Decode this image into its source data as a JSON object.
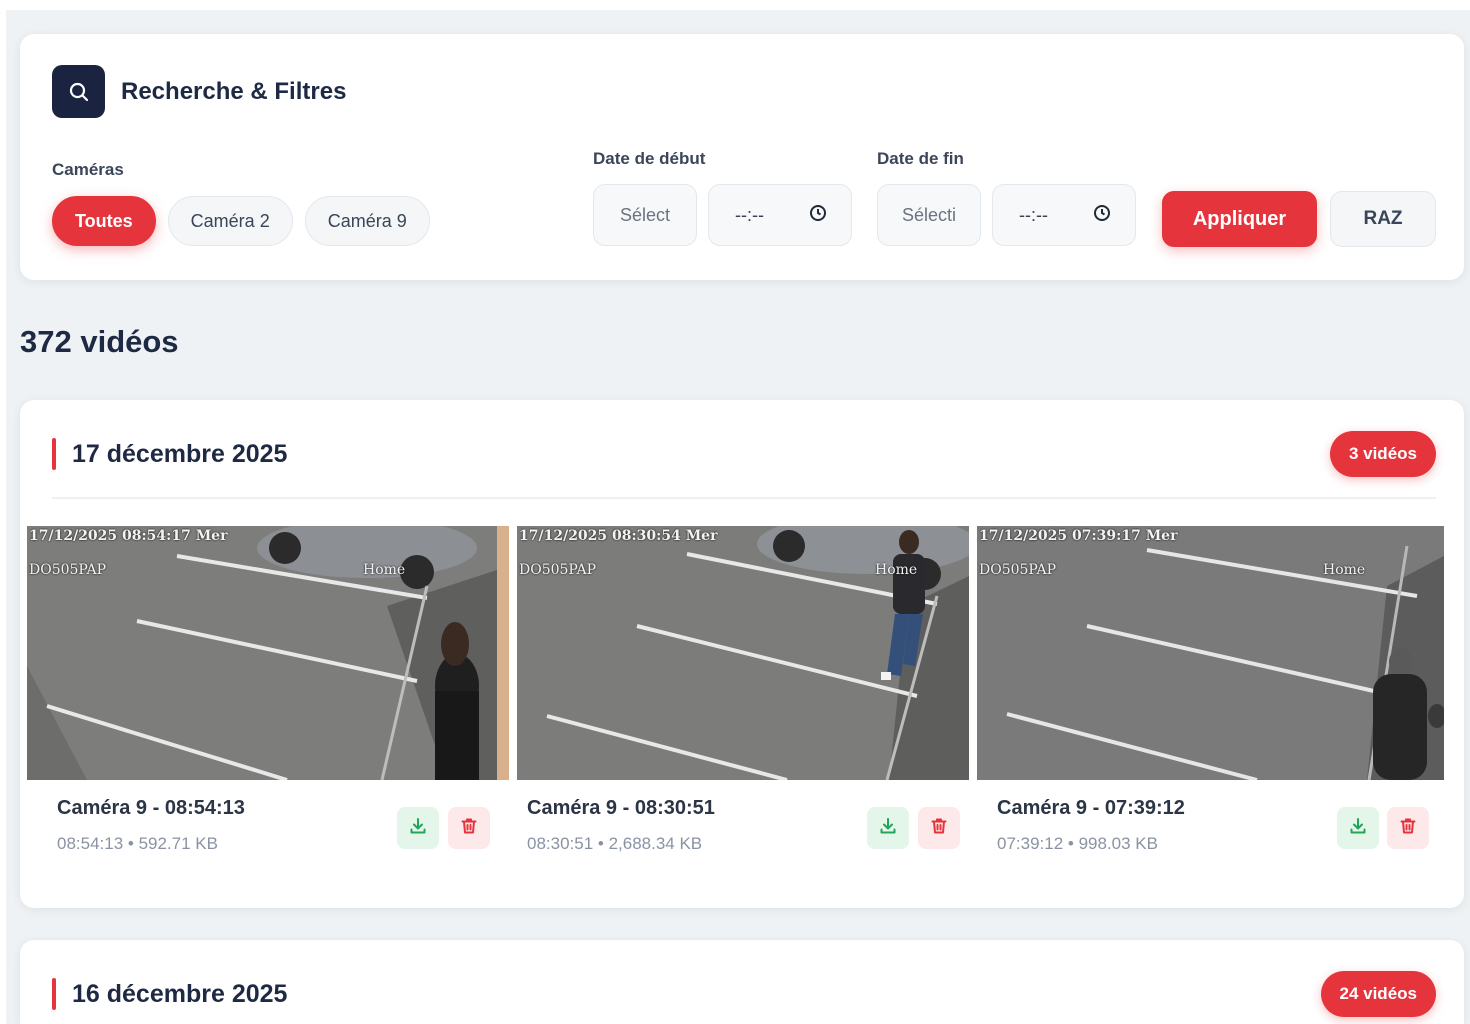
{
  "filters": {
    "title": "Recherche & Filtres",
    "cameras_label": "Caméras",
    "camera_chips": [
      "Toutes",
      "Caméra 2",
      "Caméra 9"
    ],
    "active_chip": "Toutes",
    "start_label": "Date de début",
    "end_label": "Date de fin",
    "start_date_placeholder": "Sélect",
    "start_time_value": "--:--",
    "end_date_placeholder": "Sélecti",
    "end_time_value": "--:--",
    "apply_label": "Appliquer",
    "reset_label": "RAZ"
  },
  "total_count_label": "372 vidéos",
  "days": [
    {
      "title": "17 décembre 2025",
      "badge": "3 vidéos",
      "videos": [
        {
          "title": "Caméra 9 - 08:54:13",
          "meta": "08:54:13 • 592.71 KB",
          "overlay_time": "17/12/2025 08:54:17 Mer",
          "overlay_cam": "DO505PAP",
          "overlay_home": "Home"
        },
        {
          "title": "Caméra 9 - 08:30:51",
          "meta": "08:30:51 • 2,688.34 KB",
          "overlay_time": "17/12/2025 08:30:54 Mer",
          "overlay_cam": "DO505PAP",
          "overlay_home": "Home"
        },
        {
          "title": "Caméra 9 - 07:39:12",
          "meta": "07:39:12 • 998.03 KB",
          "overlay_time": "17/12/2025 07:39:17 Mer",
          "overlay_cam": "DO505PAP",
          "overlay_home": "Home"
        }
      ]
    },
    {
      "title": "16 décembre 2025",
      "badge": "24 vidéos"
    }
  ],
  "colors": {
    "accent": "#e6343c",
    "navy": "#1a2440",
    "download_bg": "#e4f5e9",
    "delete_bg": "#fde8ea"
  },
  "icons": [
    "search-icon",
    "clock-icon",
    "download-icon",
    "trash-icon"
  ]
}
